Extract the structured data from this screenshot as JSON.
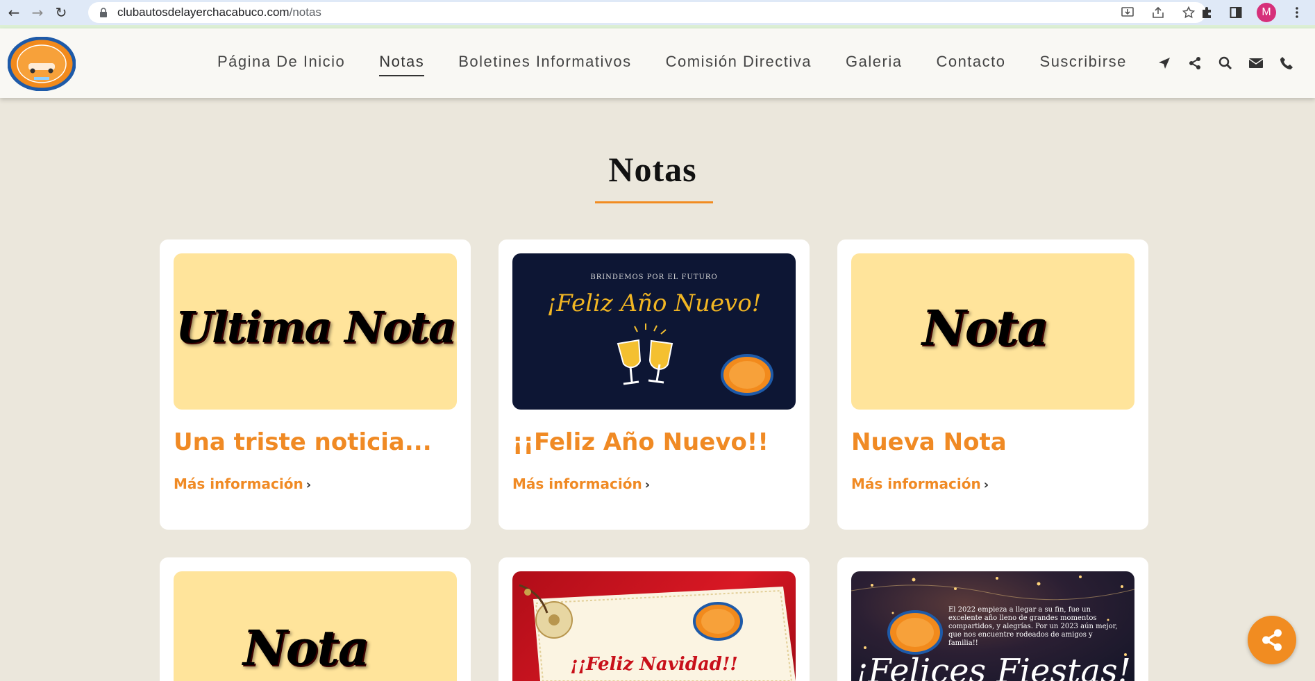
{
  "browser": {
    "url_host": "clubautosdelayerchacabuco.com",
    "url_path": "/notas",
    "profile_initial": "M"
  },
  "site": {
    "nav": [
      {
        "label": "Página De Inicio",
        "active": false
      },
      {
        "label": "Notas",
        "active": true
      },
      {
        "label": "Boletines Informativos",
        "active": false
      },
      {
        "label": "Comisión Directiva",
        "active": false
      },
      {
        "label": "Galeria",
        "active": false
      },
      {
        "label": "Contacto",
        "active": false
      },
      {
        "label": "Suscribirse",
        "active": false
      }
    ],
    "header_icons": [
      "location-arrow-icon",
      "share-icon",
      "search-icon",
      "envelope-icon",
      "phone-icon"
    ]
  },
  "page": {
    "title": "Notas"
  },
  "cards": [
    {
      "title": "Una triste noticia...",
      "link": "Más información",
      "image": {
        "kind": "yellow",
        "text": "Ultima Nota"
      }
    },
    {
      "title": "¡¡Feliz Año Nuevo!!",
      "link": "Más información",
      "image": {
        "kind": "navy",
        "caption": "BRINDEMOS POR EL FUTURO",
        "text": "¡Feliz Año Nuevo!"
      }
    },
    {
      "title": "Nueva Nota",
      "link": "Más información",
      "image": {
        "kind": "yellow",
        "text": "Nota"
      }
    },
    {
      "title": "",
      "link": "",
      "image": {
        "kind": "yellow",
        "text": "Nota"
      }
    },
    {
      "title": "",
      "link": "",
      "image": {
        "kind": "red",
        "text": "¡¡Feliz Navidad!!"
      }
    },
    {
      "title": "",
      "link": "",
      "image": {
        "kind": "night",
        "paragraph": "El 2022 empieza a llegar a su fin, fue un excelente año lleno de grandes momentos compartidos, y alegrías. Por un 2023 aún mejor, que nos encuentre rodeados de amigos y familia!!",
        "text": "¡Felices Fiestas!"
      }
    }
  ],
  "colors": {
    "accent": "#f18c21",
    "background": "#ebe7dc",
    "card_title": "#f08a24"
  },
  "fab": {
    "icon": "share-icon"
  }
}
